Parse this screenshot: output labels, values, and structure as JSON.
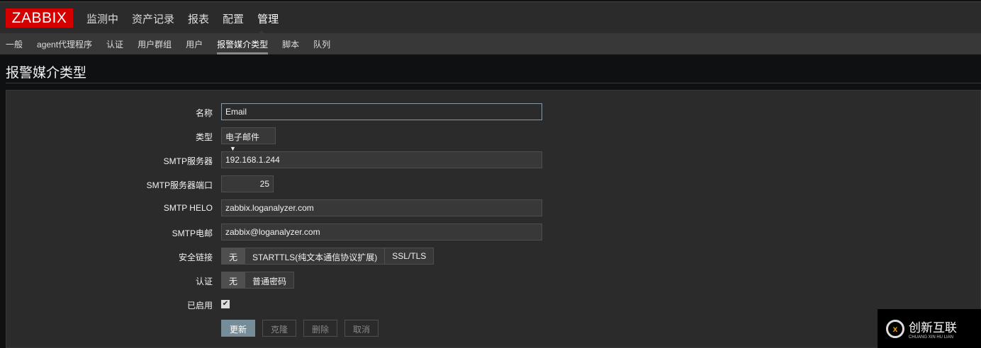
{
  "logo": "ZABBIX",
  "main_nav": [
    "监测中",
    "资产记录",
    "报表",
    "配置",
    "管理"
  ],
  "sub_nav": [
    "一般",
    "agent代理程序",
    "认证",
    "用户群组",
    "用户",
    "报警媒介类型",
    "脚本",
    "队列"
  ],
  "page_title": "报警媒介类型",
  "form": {
    "name_label": "名称",
    "name_value": "Email",
    "type_label": "类型",
    "type_value": "电子邮件",
    "smtp_server_label": "SMTP服务器",
    "smtp_server_value": "192.168.1.244",
    "smtp_port_label": "SMTP服务器端口",
    "smtp_port_value": "25",
    "smtp_helo_label": "SMTP HELO",
    "smtp_helo_value": "zabbix.loganalyzer.com",
    "smtp_email_label": "SMTP电邮",
    "smtp_email_value": "zabbix@loganalyzer.com",
    "security_label": "安全链接",
    "security_options": [
      "无",
      "STARTTLS(纯文本通信协议扩展)",
      "SSL/TLS"
    ],
    "auth_label": "认证",
    "auth_options": [
      "无",
      "普通密码"
    ],
    "enabled_label": "已启用",
    "enabled": true
  },
  "buttons": {
    "update": "更新",
    "clone": "克隆",
    "delete": "删除",
    "cancel": "取消"
  },
  "watermark": {
    "title": "创新互联",
    "subtitle": "CHUANG XIN HU LIAN"
  }
}
